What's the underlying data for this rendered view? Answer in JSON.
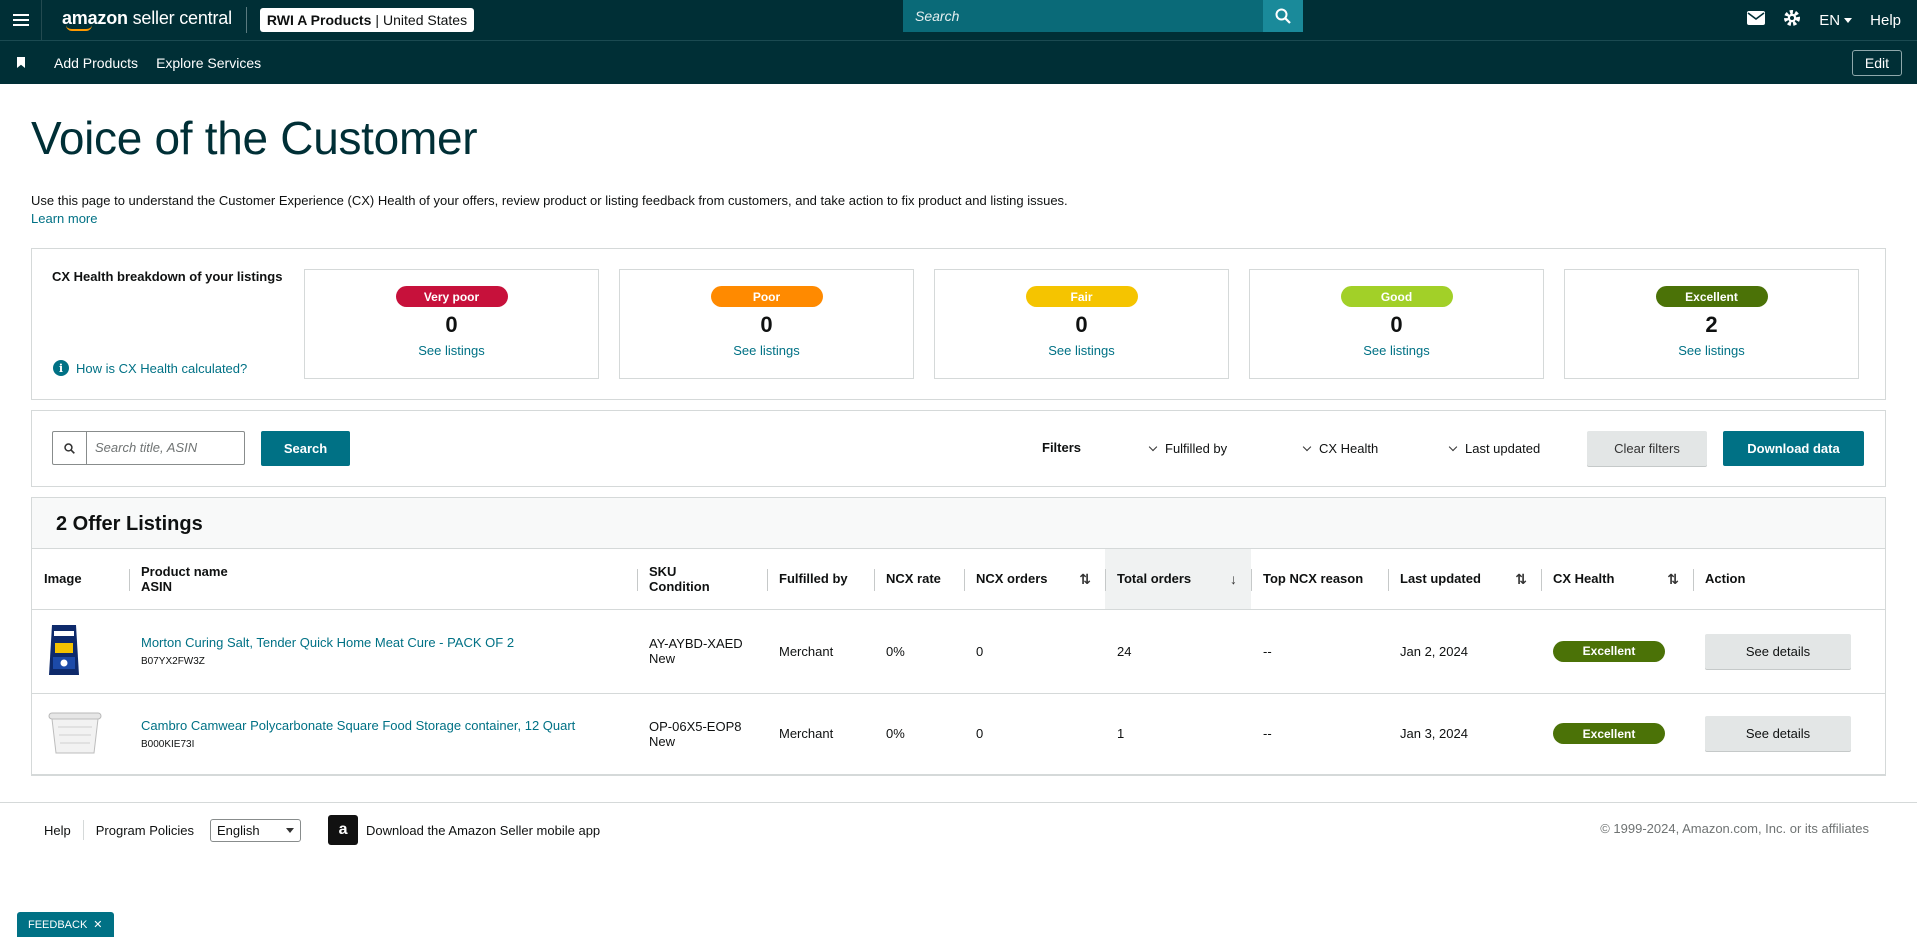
{
  "topbar": {
    "logo_text_bold": "amazon",
    "logo_text_rest": " seller central",
    "store_name": "RWI A Products",
    "store_region": "United States",
    "search_placeholder": "Search",
    "lang": "EN",
    "help": "Help"
  },
  "subnav": {
    "links": [
      "Add Products",
      "Explore Services"
    ],
    "edit": "Edit"
  },
  "page": {
    "title": "Voice of the Customer",
    "intro": "Use this page to understand the Customer Experience (CX) Health of your offers, review product or listing feedback from customers, and take action to fix product and listing issues.",
    "learn_more": "Learn more"
  },
  "health": {
    "title": "CX Health breakdown of your listings",
    "how_calc": "How is CX Health calculated?",
    "tiles": [
      {
        "label": "Very poor",
        "count": "0",
        "link": "See listings",
        "color": "#c7113b"
      },
      {
        "label": "Poor",
        "count": "0",
        "link": "See listings",
        "color": "#ff8a00"
      },
      {
        "label": "Fair",
        "count": "0",
        "link": "See listings",
        "color": "#f5c400"
      },
      {
        "label": "Good",
        "count": "0",
        "link": "See listings",
        "color": "#a2d028"
      },
      {
        "label": "Excellent",
        "count": "2",
        "link": "See listings",
        "color": "#4b7207"
      }
    ]
  },
  "filters": {
    "search_placeholder": "Search title, ASIN",
    "search_btn": "Search",
    "label": "Filters",
    "fulfilled_by": "Fulfilled by",
    "cx_health": "CX Health",
    "last_updated": "Last updated",
    "clear": "Clear filters",
    "download": "Download data"
  },
  "listings": {
    "heading": "2 Offer Listings",
    "columns": {
      "image": "Image",
      "product_name": "Product name",
      "asin": "ASIN",
      "sku": "SKU",
      "condition": "Condition",
      "fulfilled_by": "Fulfilled by",
      "ncx_rate": "NCX rate",
      "ncx_orders": "NCX orders",
      "total_orders": "Total orders",
      "top_reason": "Top NCX reason",
      "last_updated": "Last updated",
      "cx_health": "CX Health",
      "action": "Action"
    },
    "rows": [
      {
        "name": "Morton Curing Salt, Tender Quick Home Meat Cure - PACK OF 2",
        "asin": "B07YX2FW3Z",
        "sku": "AY-AYBD-XAED",
        "condition": "New",
        "fulfilled_by": "Merchant",
        "ncx_rate": "0%",
        "ncx_orders": "0",
        "total_orders": "24",
        "top_reason": "--",
        "last_updated": "Jan 2, 2024",
        "cx_health": "Excellent",
        "action": "See details"
      },
      {
        "name": "Cambro Camwear Polycarbonate Square Food Storage container, 12 Quart",
        "asin": "B000KIE73I",
        "sku": "OP-06X5-EOP8",
        "condition": "New",
        "fulfilled_by": "Merchant",
        "ncx_rate": "0%",
        "ncx_orders": "0",
        "total_orders": "1",
        "top_reason": "--",
        "last_updated": "Jan 3, 2024",
        "cx_health": "Excellent",
        "action": "See details"
      }
    ]
  },
  "footer": {
    "help": "Help",
    "policies": "Program Policies",
    "language": "English",
    "app_text": "Download the Amazon Seller mobile app",
    "copyright": "© 1999-2024, Amazon.com, Inc. or its affiliates"
  },
  "feedback": "FEEDBACK"
}
